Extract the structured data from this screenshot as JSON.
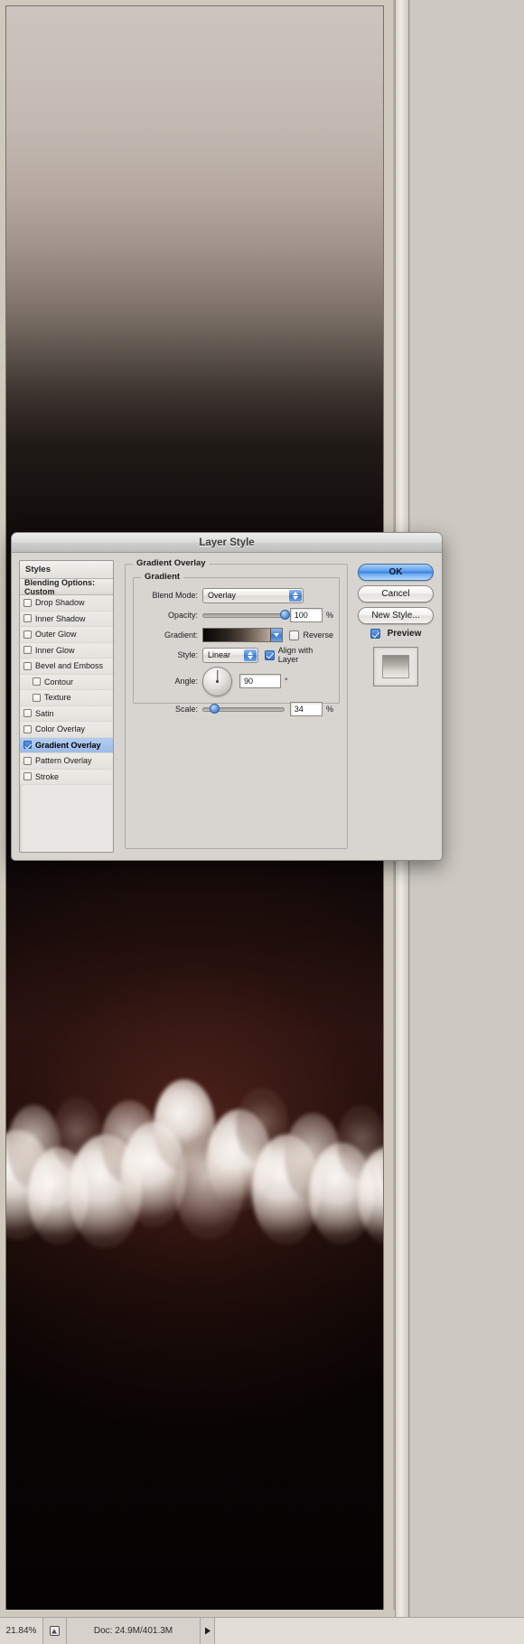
{
  "dialog": {
    "title": "Layer Style",
    "styles_panel": {
      "header": "Styles",
      "blending_options": "Blending Options: Custom",
      "items": [
        {
          "label": "Drop Shadow",
          "checked": false,
          "indent": false,
          "selected": false
        },
        {
          "label": "Inner Shadow",
          "checked": false,
          "indent": false,
          "selected": false
        },
        {
          "label": "Outer Glow",
          "checked": false,
          "indent": false,
          "selected": false
        },
        {
          "label": "Inner Glow",
          "checked": false,
          "indent": false,
          "selected": false
        },
        {
          "label": "Bevel and Emboss",
          "checked": false,
          "indent": false,
          "selected": false
        },
        {
          "label": "Contour",
          "checked": false,
          "indent": true,
          "selected": false
        },
        {
          "label": "Texture",
          "checked": false,
          "indent": true,
          "selected": false
        },
        {
          "label": "Satin",
          "checked": false,
          "indent": false,
          "selected": false
        },
        {
          "label": "Color Overlay",
          "checked": false,
          "indent": false,
          "selected": false
        },
        {
          "label": "Gradient Overlay",
          "checked": true,
          "indent": false,
          "selected": true
        },
        {
          "label": "Pattern Overlay",
          "checked": false,
          "indent": false,
          "selected": false
        },
        {
          "label": "Stroke",
          "checked": false,
          "indent": false,
          "selected": false
        }
      ]
    },
    "main_panel": {
      "group_title": "Gradient Overlay",
      "inner_group_title": "Gradient",
      "blend_mode": {
        "label": "Blend Mode:",
        "value": "Overlay"
      },
      "opacity": {
        "label": "Opacity:",
        "value": "100",
        "unit": "%",
        "percent": 100
      },
      "gradient": {
        "label": "Gradient:",
        "from_color": "#080604",
        "to_color": "#ded6cb"
      },
      "reverse": {
        "label": "Reverse",
        "checked": false
      },
      "style": {
        "label": "Style:",
        "value": "Linear"
      },
      "align_with_layer": {
        "label": "Align with Layer",
        "checked": true
      },
      "angle": {
        "label": "Angle:",
        "value": "90",
        "unit": "°"
      },
      "scale": {
        "label": "Scale:",
        "value": "34",
        "unit": "%",
        "percent": 34
      }
    },
    "buttons": {
      "ok": "OK",
      "cancel": "Cancel",
      "new_style": "New Style...",
      "preview": {
        "label": "Preview",
        "checked": true
      }
    }
  },
  "statusbar": {
    "zoom": "21.84%",
    "doc_info": "Doc: 24.9M/401.3M",
    "icon": "page-preview-icon",
    "arrow": "play-arrow-icon"
  },
  "colors": {
    "accent_blue": "#3a7fdc",
    "selection_blue": "#9dbbe6",
    "dialog_bg": "#d8d5d0",
    "canvas_dark": "#0a0503",
    "sky_top": "#cdc4bf"
  }
}
